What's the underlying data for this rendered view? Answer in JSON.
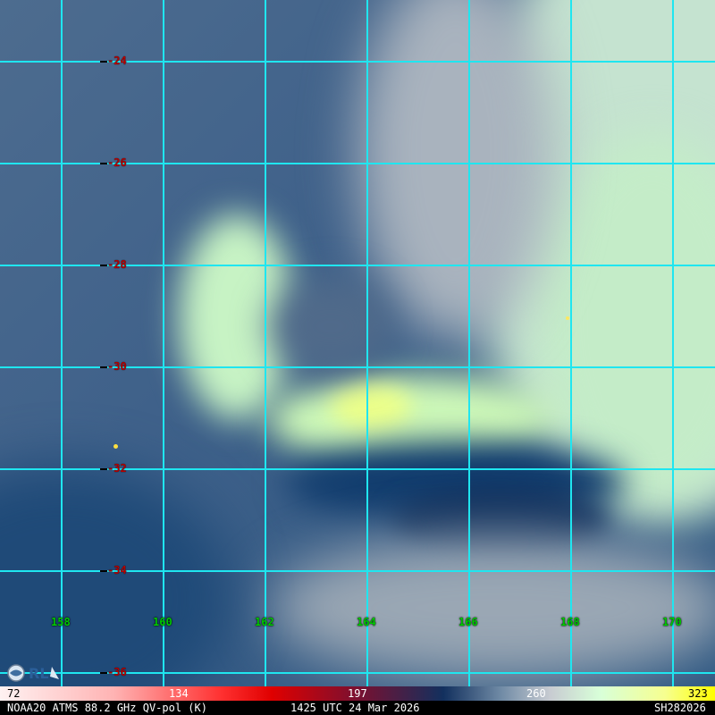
{
  "grid": {
    "latitudes": [
      "-24",
      "-26",
      "-28",
      "-30",
      "-32",
      "-34",
      "-36"
    ],
    "longitudes": [
      "158",
      "160",
      "162",
      "164",
      "166",
      "168",
      "170"
    ]
  },
  "colorbar": {
    "ticks": [
      "72",
      "134",
      "197",
      "260",
      "323"
    ]
  },
  "footer": {
    "instrument": "NOAA20 ATMS 88.2 GHz QV-pol (K)",
    "time": "1425 UTC 24 Mar 2026",
    "storm_id": "SH282026"
  },
  "colors": {
    "grid_line": "#1fe6f0",
    "lat_label": "#b30000",
    "lon_label": "#00c800"
  }
}
